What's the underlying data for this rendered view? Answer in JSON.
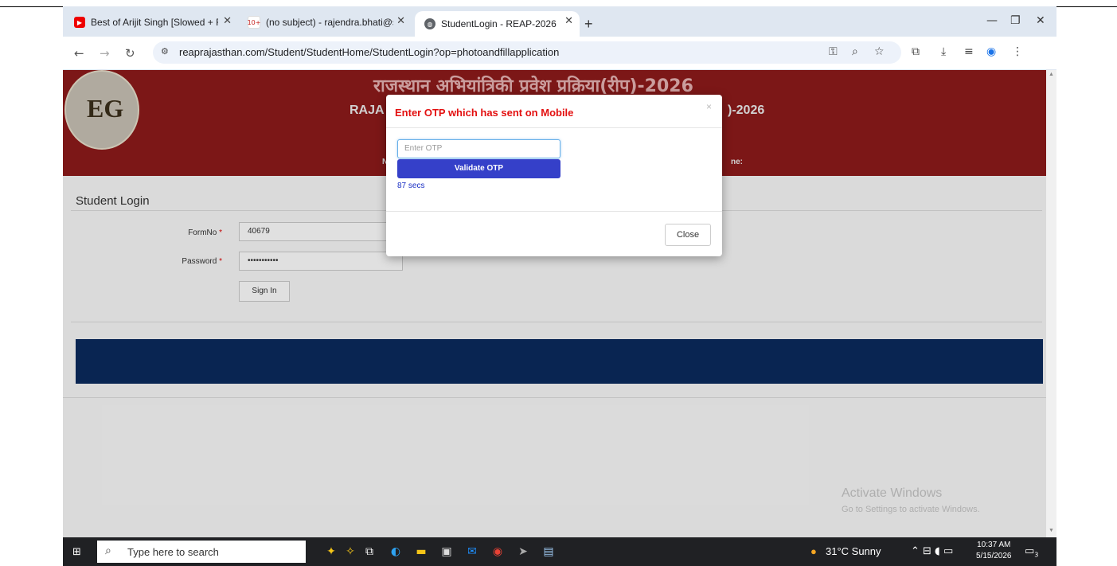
{
  "browser": {
    "tabs": [
      {
        "title": "Best of Arijit Singh [Slowed + R",
        "icon": "youtube-icon",
        "active": false
      },
      {
        "title": "(no subject) - rajendra.bhati@s",
        "icon": "gmail-icon",
        "badge": "10+",
        "active": false
      },
      {
        "title": "StudentLogin - REAP-2026",
        "icon": "globe-icon",
        "active": true
      }
    ],
    "url": "reaprajasthan.com/Student/StudentHome/StudentLogin?op=photoandfillapplication"
  },
  "page": {
    "header_hindi": "राजस्थान अभियांत्रिकी प्रवेश प्रक्रिया(रीप)-2026",
    "header_english_left": "RAJA",
    "header_english_right": ")-2026",
    "header_small_left": "N",
    "header_small_right": "ne:",
    "login_title": "Student Login",
    "formno_label": "FormNo",
    "formno_value": "40679",
    "password_label": "Password",
    "password_value": "•••••••••••",
    "signin_label": "Sign In",
    "watermark_title": "Activate Windows",
    "watermark_sub": "Go to Settings to activate Windows."
  },
  "modal": {
    "title": "Enter OTP which has sent on Mobile",
    "close_x": "×",
    "otp_placeholder": "Enter OTP",
    "validate_label": "Validate OTP",
    "timer": "87 secs",
    "close_label": "Close"
  },
  "taskbar": {
    "search_placeholder": "Type here to search",
    "weather": "31°C  Sunny",
    "time": "10:37 AM",
    "date": "5/15/2026",
    "notification_count": "3"
  },
  "colors": {
    "banner": "#8e1b1b",
    "modal_title": "#e31010",
    "validate_button": "#3540c9",
    "nav_band": "#0b2b5e"
  }
}
